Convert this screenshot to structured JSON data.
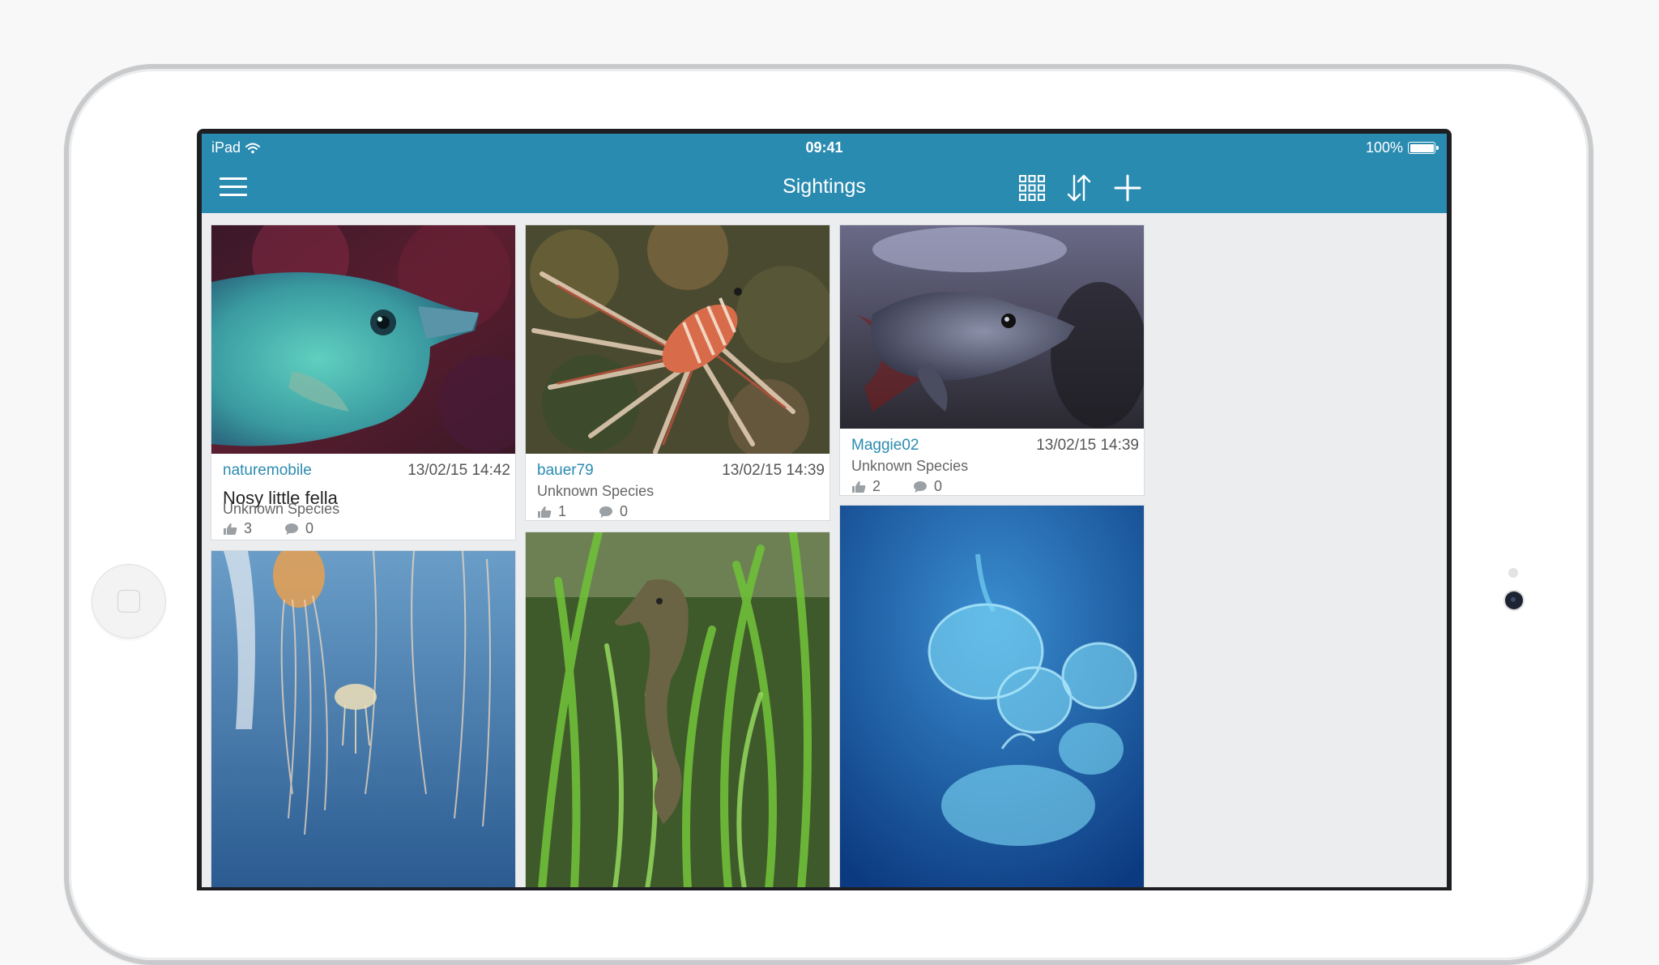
{
  "status_bar": {
    "device": "iPad",
    "time": "09:41",
    "battery": "100%"
  },
  "nav": {
    "title": "Sightings"
  },
  "icons": {
    "menu": "hamburger-menu-icon",
    "grid": "grid-view-icon",
    "sort": "sort-icon",
    "add": "plus-icon",
    "like": "thumbs-up-icon",
    "comment": "comment-bubble-icon",
    "wifi": "wifi-icon",
    "battery": "battery-icon"
  },
  "colors": {
    "accent": "#2a8bb0",
    "background": "#ebedee"
  },
  "sightings": [
    {
      "user": "naturemobile",
      "date": "13/02/15 14:42",
      "title": "Nosy little fella",
      "species": "Unknown Species",
      "likes": "3",
      "comments": "0"
    },
    {
      "user": "bauer79",
      "date": "13/02/15 14:39",
      "title": "",
      "species": "Unknown Species",
      "likes": "1",
      "comments": "0"
    },
    {
      "user": "Maggie02",
      "date": "13/02/15 14:39",
      "title": "",
      "species": "Unknown Species",
      "likes": "2",
      "comments": "0"
    }
  ]
}
